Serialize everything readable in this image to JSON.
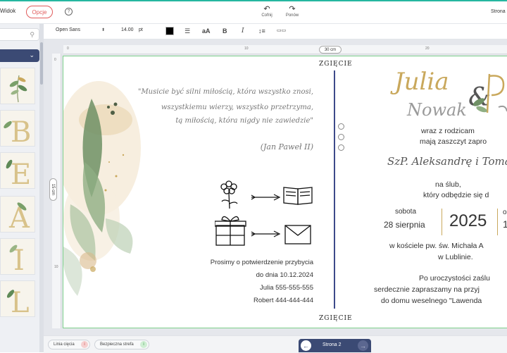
{
  "topbar": {
    "view_label": "Widok",
    "options_label": "Opcje",
    "help_icon": "?",
    "undo_label": "Cofnij",
    "redo_label": "Ponów",
    "right_label": "Strona"
  },
  "format_toolbar": {
    "font_family": "Open Sans",
    "font_size": "14.00",
    "font_unit": "pt",
    "text_color": "#000000",
    "icons": [
      "align-center-icon",
      "text-case-icon",
      "bold-icon",
      "italic-icon",
      "line-spacing-icon",
      "letter-spacing-icon"
    ]
  },
  "rulers": {
    "h_labels": [
      "0",
      "10",
      "20"
    ],
    "v_labels": [
      "0",
      "10"
    ],
    "width_label": "30 cm",
    "height_label": "15 cm"
  },
  "card": {
    "fold_label": "ZGIĘCIE",
    "quote_lines": [
      "\"Musicie być silni miłością, która wszystko znosi,",
      "wszystkiemu wierzy, wszystko przetrzyma,",
      "tą miłością, która nigdy nie zawiedzie\""
    ],
    "quote_author": "(Jan Paweł II)",
    "rsvp_lines": [
      "Prosimy o potwierdzenie przybycia",
      "do dnia 10.12.2024",
      "Julia 555-555-555",
      "Robert 444-444-444"
    ],
    "bride_first": "Julia",
    "bride_last": "Nowak",
    "ampersand": "&",
    "intro_lines": [
      "wraz z rodzicam",
      "mają zaszczyt zapro"
    ],
    "guest_name": "SzP. Aleksandrę i Tomasz",
    "wedding_lines": [
      "na ślub,",
      "który odbędzie się d"
    ],
    "day_of_week": "sobota",
    "date": "28 sierpnia",
    "year": "2025",
    "church_lines": [
      "w kościele pw. św. Michała A",
      "w Lublinie."
    ],
    "reception_lines": [
      "Po uroczystości zaślu",
      "serdecznie zapraszamy na przyj",
      "do domu weselnego \"Lawenda"
    ]
  },
  "bottombar": {
    "cut_line_label": "Linia cięcia",
    "safe_zone_label": "Bezpieczna strefa",
    "page_label": "Strona 2"
  },
  "colors": {
    "accent_teal": "#25b7a0",
    "options_red": "#e05a5a",
    "navy": "#3b4a74",
    "gold": "#c9a85c",
    "safe_green": "#7ccf8a"
  }
}
